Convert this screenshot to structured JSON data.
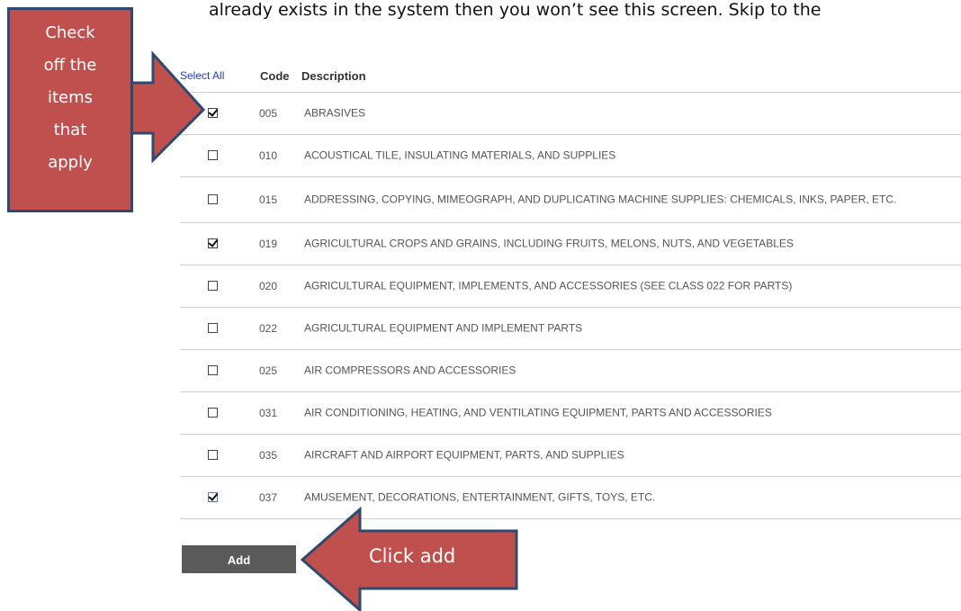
{
  "intro_text": "already exists in the system then you won’t see this screen. Skip to the",
  "table": {
    "select_all": "Select All",
    "col_code": "Code",
    "col_description": "Description",
    "rows": [
      {
        "code": "005",
        "description": "ABRASIVES",
        "checked": true
      },
      {
        "code": "010",
        "description": "ACOUSTICAL TILE, INSULATING MATERIALS, AND SUPPLIES",
        "checked": false
      },
      {
        "code": "015",
        "description": "ADDRESSING, COPYING, MIMEOGRAPH, AND DUPLICATING MACHINE SUPPLIES: CHEMICALS, INKS, PAPER, ETC.",
        "checked": false
      },
      {
        "code": "019",
        "description": "AGRICULTURAL CROPS AND GRAINS, INCLUDING FRUITS, MELONS, NUTS, AND VEGETABLES",
        "checked": true
      },
      {
        "code": "020",
        "description": "AGRICULTURAL EQUIPMENT, IMPLEMENTS, AND ACCESSORIES (SEE CLASS 022 FOR PARTS)",
        "checked": false
      },
      {
        "code": "022",
        "description": "AGRICULTURAL EQUIPMENT AND IMPLEMENT PARTS",
        "checked": false
      },
      {
        "code": "025",
        "description": "AIR COMPRESSORS AND ACCESSORIES",
        "checked": false
      },
      {
        "code": "031",
        "description": "AIR CONDITIONING, HEATING, AND VENTILATING EQUIPMENT, PARTS AND ACCESSORIES",
        "checked": false
      },
      {
        "code": "035",
        "description": "AIRCRAFT AND AIRPORT EQUIPMENT, PARTS, AND SUPPLIES",
        "checked": false
      },
      {
        "code": "037",
        "description": "AMUSEMENT, DECORATIONS, ENTERTAINMENT, GIFTS, TOYS, ETC.",
        "checked": true
      }
    ]
  },
  "add_button_label": "Add",
  "callouts": {
    "check_items": [
      "Check",
      "off the",
      "items",
      "that",
      "apply"
    ],
    "click_add": "Click add"
  },
  "colors": {
    "callout_fill": "#c0504d",
    "callout_border": "#2f4a6e",
    "button_bg": "#5a5a5a",
    "link": "#1a3fbf"
  }
}
